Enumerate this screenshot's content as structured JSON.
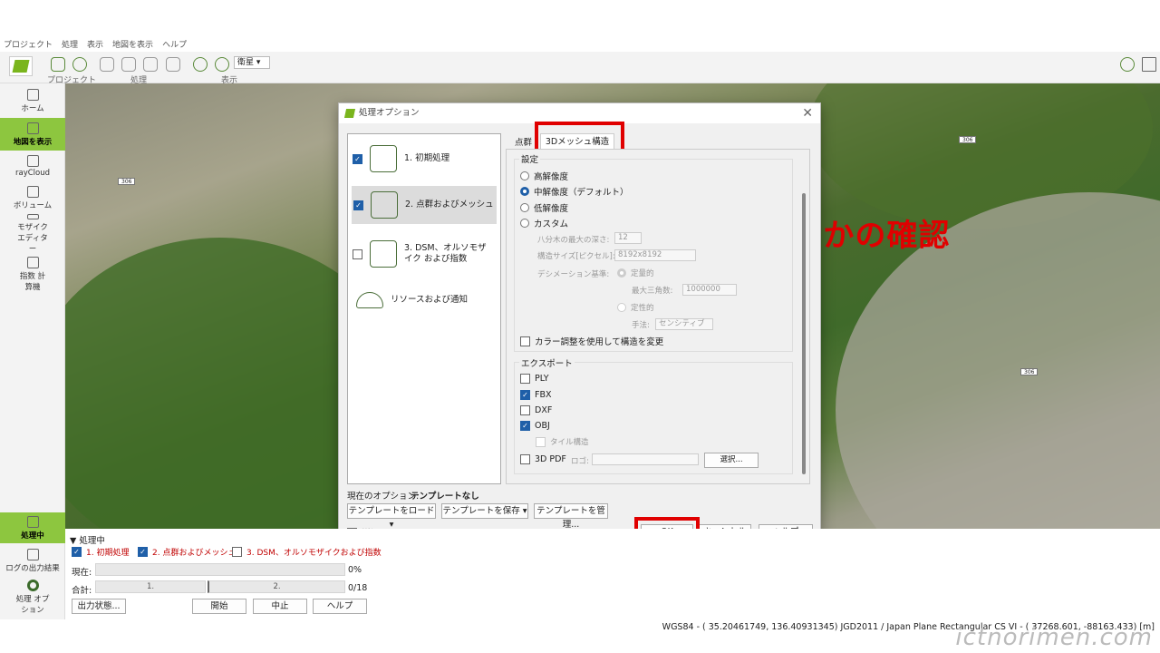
{
  "menu": [
    "プロジェクト",
    "処理",
    "表示",
    "地図を表示",
    "ヘルプ"
  ],
  "toolbar": {
    "groups": [
      "プロジェクト",
      "処理",
      "表示"
    ],
    "basemap": "衛星"
  },
  "sidebar": [
    {
      "label": "ホーム",
      "icon": "home-icon"
    },
    {
      "label": "地図を表示",
      "icon": "map-icon",
      "active": true
    },
    {
      "label": "rayCloud",
      "icon": "raycloud-icon"
    },
    {
      "label": "ボリューム",
      "icon": "volume-icon"
    },
    {
      "label": "モザイク エディター",
      "icon": "mosaic-editor-icon"
    },
    {
      "label": "指数 計算機",
      "icon": "index-calculator-icon"
    }
  ],
  "sidebar_bottom": [
    {
      "label": "処理中",
      "icon": "processing-icon",
      "active": true
    },
    {
      "label": "ログの出力結果",
      "icon": "log-icon"
    },
    {
      "label": "処理 オプション",
      "icon": "gear-icon"
    }
  ],
  "map_labels": [
    "306",
    "306",
    "306"
  ],
  "dialog": {
    "title": "処理オプション",
    "steps": [
      {
        "label": "1. 初期処理",
        "checked": true
      },
      {
        "label": "2. 点群およびメッシュ",
        "checked": true,
        "selected": true
      },
      {
        "label": "3. DSM、オルソモザイク および指数",
        "checked": false
      },
      {
        "label": "リソースおよび通知"
      }
    ],
    "tabs": [
      "点群",
      "3Dメッシュ構造"
    ],
    "settings": {
      "title": "設定",
      "options": [
        "高解像度",
        "中解像度（デフォルト）",
        "低解像度",
        "カスタム"
      ],
      "selected": 1,
      "octree_label": "八分木の最大の深さ:",
      "octree_value": "12",
      "texture_label": "構造サイズ[ピクセル]:",
      "texture_value": "8192x8192",
      "decimation_label": "デシメーション基準:",
      "quant_label": "定量的",
      "max_tri_label": "最大三角数:",
      "max_tri_value": "1000000",
      "qual_label": "定性的",
      "method_label": "手法:",
      "method_value": "センシティブ",
      "color_balance": "カラー調整を使用して構造を変更"
    },
    "export": {
      "title": "エクスポート",
      "formats": [
        {
          "label": "PLY",
          "checked": false
        },
        {
          "label": "FBX",
          "checked": true
        },
        {
          "label": "DXF",
          "checked": false
        },
        {
          "label": "OBJ",
          "checked": true
        }
      ],
      "tiled": "タイル構造",
      "pdf": "3D PDF",
      "logo_label": "ロゴ:",
      "browse": "選択..."
    },
    "current_option_label": "現在のオプション:",
    "current_option_value": "テンプレートなし",
    "template_buttons": [
      "テンプレートをロード",
      "テンプレートを保存",
      "テンプレートを管理..."
    ],
    "advanced": "詳細",
    "ok": "OK",
    "cancel": "キャンセル",
    "help": "ヘルプ"
  },
  "annotation": "何にするかの確認",
  "processing": {
    "header": "処理中",
    "steps": [
      {
        "label": "1. 初期処理",
        "checked": true
      },
      {
        "label": "2. 点群およびメッシュ",
        "checked": true
      },
      {
        "label": "3. DSM、オルソモザイクおよび指数",
        "checked": false
      }
    ],
    "current_label": "現在:",
    "current_value": "0%",
    "total_label": "合計:",
    "total_seg1": "1.",
    "total_seg2": "2.",
    "total_value": "0/18",
    "output_button": "出力状態...",
    "start": "開始",
    "stop": "中止",
    "help": "ヘルプ"
  },
  "status": "WGS84 - ( 35.20461749,  136.40931345) JGD2011 / Japan Plane Rectangular CS VI - (    37268.601,    -88163.433) [m]",
  "watermark": "ictnorimen.com"
}
